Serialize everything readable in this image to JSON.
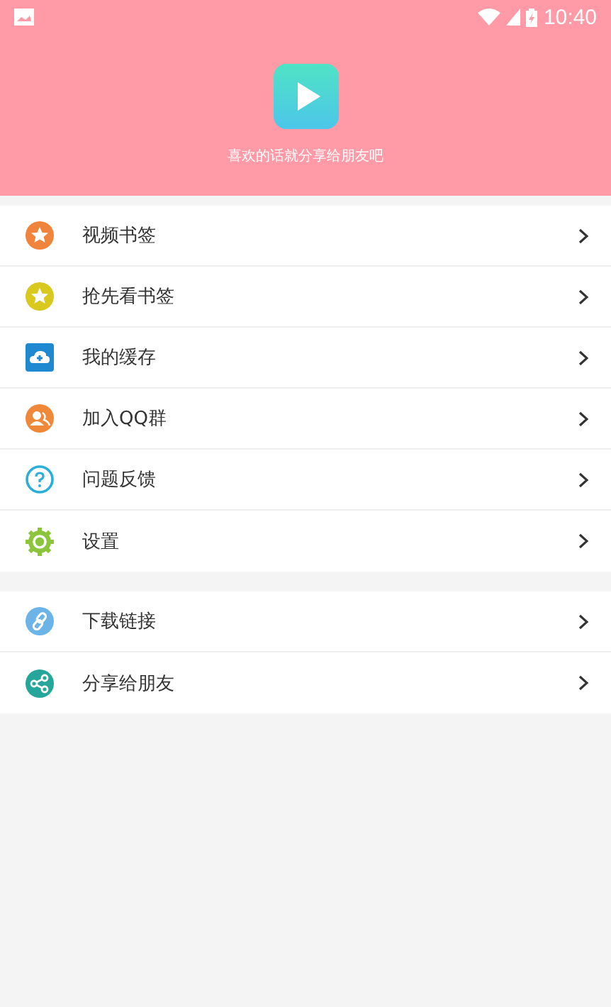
{
  "status_bar": {
    "time": "10:40"
  },
  "header": {
    "tagline": "喜欢的话就分享给朋友吧"
  },
  "menu_groups": [
    {
      "items": [
        {
          "label": "视频书签",
          "kind": "star-badge",
          "color": "#f0843c"
        },
        {
          "label": "抢先看书签",
          "kind": "star-badge",
          "color": "#d9c81e"
        },
        {
          "label": "我的缓存",
          "kind": "cloud",
          "color": "#1e88d0"
        },
        {
          "label": "加入QQ群",
          "kind": "people",
          "color": "#f0883a"
        },
        {
          "label": "问题反馈",
          "kind": "question",
          "color": "#2ab0d8"
        },
        {
          "label": "设置",
          "kind": "gear",
          "color": "#8cc43c"
        }
      ]
    },
    {
      "items": [
        {
          "label": "下载链接",
          "kind": "link",
          "color": "#6cb4e8"
        },
        {
          "label": "分享给朋友",
          "kind": "share",
          "color": "#26a69a"
        }
      ]
    }
  ]
}
